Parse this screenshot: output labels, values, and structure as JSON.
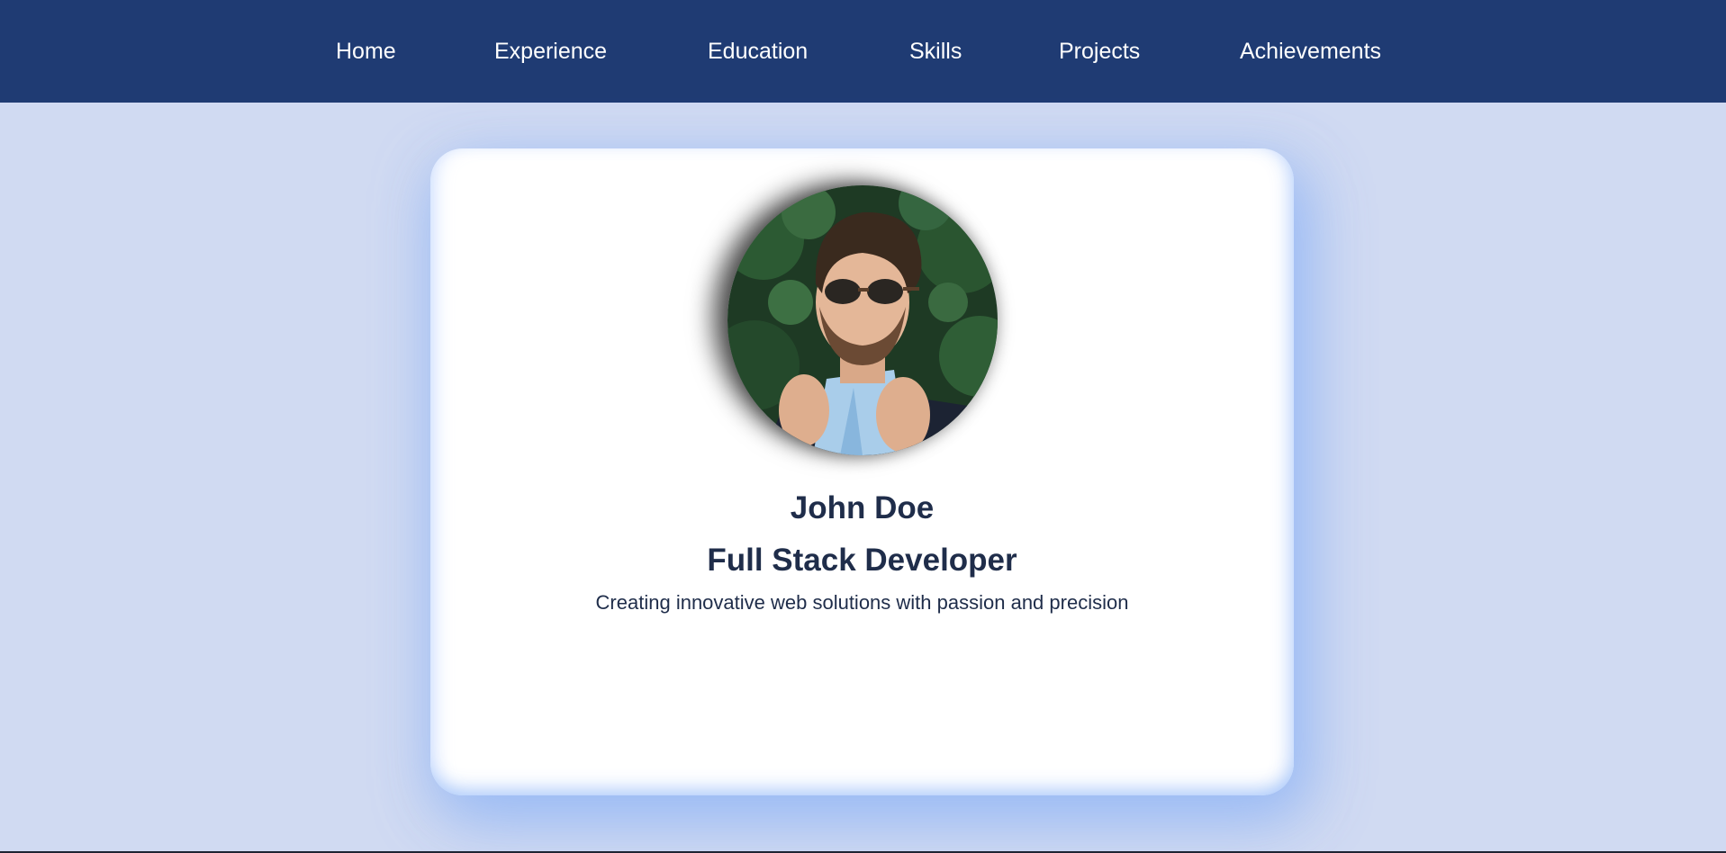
{
  "nav": {
    "items": [
      {
        "label": "Home"
      },
      {
        "label": "Experience"
      },
      {
        "label": "Education"
      },
      {
        "label": "Skills"
      },
      {
        "label": "Projects"
      },
      {
        "label": "Achievements"
      }
    ]
  },
  "profile": {
    "name": "John Doe",
    "title": "Full Stack Developer",
    "tagline": "Creating innovative web solutions with passion and precision",
    "avatar_alt": "profile-photo"
  },
  "colors": {
    "navbar": "#1f3b73",
    "page_background": "#d0daf2",
    "card": "#ffffff",
    "text": "#1f2d4a",
    "nav_text": "#ffffff"
  }
}
